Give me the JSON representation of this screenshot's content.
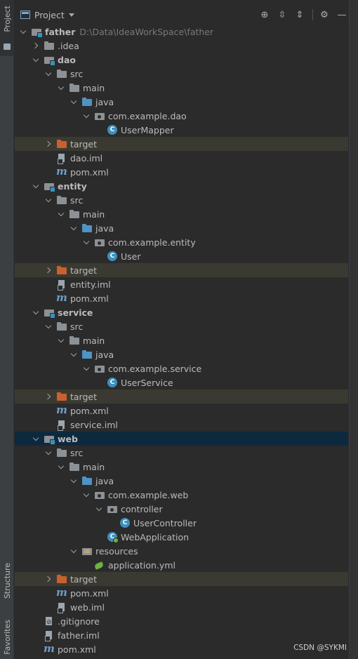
{
  "sidebar": {
    "project_label": "Project",
    "structure_label": "Structure",
    "favorites_label": "Favorites"
  },
  "header": {
    "title": "Project",
    "tools": [
      "locate-icon",
      "expand-all-icon",
      "collapse-all-icon",
      "gear-icon",
      "minimize-icon"
    ]
  },
  "tree": {
    "rows": [
      {
        "name": "father",
        "path": "D:\\Data\\IdeaWorkSpace\\father",
        "depth": 0,
        "arrow": "open",
        "icon": "module",
        "bold": true
      },
      {
        "name": ".idea",
        "depth": 1,
        "arrow": "closed",
        "icon": "folder-grey"
      },
      {
        "name": "dao",
        "depth": 1,
        "arrow": "open",
        "icon": "module",
        "bold": true
      },
      {
        "name": "src",
        "depth": 2,
        "arrow": "open",
        "icon": "folder-grey"
      },
      {
        "name": "main",
        "depth": 3,
        "arrow": "open",
        "icon": "folder-grey"
      },
      {
        "name": "java",
        "depth": 4,
        "arrow": "open",
        "icon": "folder-blue"
      },
      {
        "name": "com.example.dao",
        "depth": 5,
        "arrow": "open",
        "icon": "package"
      },
      {
        "name": "UserMapper",
        "depth": 6,
        "arrow": "none",
        "icon": "class"
      },
      {
        "name": "target",
        "depth": 2,
        "arrow": "closed",
        "icon": "folder-orange",
        "excluded": true
      },
      {
        "name": "dao.iml",
        "depth": 2,
        "arrow": "none",
        "icon": "iml"
      },
      {
        "name": "pom.xml",
        "depth": 2,
        "arrow": "none",
        "icon": "pom"
      },
      {
        "name": "entity",
        "depth": 1,
        "arrow": "open",
        "icon": "module",
        "bold": true
      },
      {
        "name": "src",
        "depth": 2,
        "arrow": "open",
        "icon": "folder-grey"
      },
      {
        "name": "main",
        "depth": 3,
        "arrow": "open",
        "icon": "folder-grey"
      },
      {
        "name": "java",
        "depth": 4,
        "arrow": "open",
        "icon": "folder-blue"
      },
      {
        "name": "com.example.entity",
        "depth": 5,
        "arrow": "open",
        "icon": "package"
      },
      {
        "name": "User",
        "depth": 6,
        "arrow": "none",
        "icon": "class"
      },
      {
        "name": "target",
        "depth": 2,
        "arrow": "closed",
        "icon": "folder-orange",
        "excluded": true
      },
      {
        "name": "entity.iml",
        "depth": 2,
        "arrow": "none",
        "icon": "iml"
      },
      {
        "name": "pom.xml",
        "depth": 2,
        "arrow": "none",
        "icon": "pom"
      },
      {
        "name": "service",
        "depth": 1,
        "arrow": "open",
        "icon": "module",
        "bold": true
      },
      {
        "name": "src",
        "depth": 2,
        "arrow": "open",
        "icon": "folder-grey"
      },
      {
        "name": "main",
        "depth": 3,
        "arrow": "open",
        "icon": "folder-grey"
      },
      {
        "name": "java",
        "depth": 4,
        "arrow": "open",
        "icon": "folder-blue"
      },
      {
        "name": "com.example.service",
        "depth": 5,
        "arrow": "open",
        "icon": "package"
      },
      {
        "name": "UserService",
        "depth": 6,
        "arrow": "none",
        "icon": "class"
      },
      {
        "name": "target",
        "depth": 2,
        "arrow": "closed",
        "icon": "folder-orange",
        "excluded": true
      },
      {
        "name": "pom.xml",
        "depth": 2,
        "arrow": "none",
        "icon": "pom"
      },
      {
        "name": "service.iml",
        "depth": 2,
        "arrow": "none",
        "icon": "iml"
      },
      {
        "name": "web",
        "depth": 1,
        "arrow": "open",
        "icon": "module",
        "bold": true,
        "selected": true
      },
      {
        "name": "src",
        "depth": 2,
        "arrow": "open",
        "icon": "folder-grey"
      },
      {
        "name": "main",
        "depth": 3,
        "arrow": "open",
        "icon": "folder-grey"
      },
      {
        "name": "java",
        "depth": 4,
        "arrow": "open",
        "icon": "folder-blue"
      },
      {
        "name": "com.example.web",
        "depth": 5,
        "arrow": "open",
        "icon": "package"
      },
      {
        "name": "controller",
        "depth": 6,
        "arrow": "open",
        "icon": "package"
      },
      {
        "name": "UserController",
        "depth": 7,
        "arrow": "none",
        "icon": "class"
      },
      {
        "name": "WebApplication",
        "depth": 6,
        "arrow": "none",
        "icon": "boot-class"
      },
      {
        "name": "resources",
        "depth": 4,
        "arrow": "open",
        "icon": "resources"
      },
      {
        "name": "application.yml",
        "depth": 5,
        "arrow": "none",
        "icon": "yml"
      },
      {
        "name": "target",
        "depth": 2,
        "arrow": "closed",
        "icon": "folder-orange",
        "excluded": true
      },
      {
        "name": "pom.xml",
        "depth": 2,
        "arrow": "none",
        "icon": "pom"
      },
      {
        "name": "web.iml",
        "depth": 2,
        "arrow": "none",
        "icon": "iml"
      },
      {
        "name": ".gitignore",
        "depth": 1,
        "arrow": "none",
        "icon": "gitignore"
      },
      {
        "name": "father.iml",
        "depth": 1,
        "arrow": "none",
        "icon": "iml"
      },
      {
        "name": "pom.xml",
        "depth": 1,
        "arrow": "none",
        "icon": "pom"
      }
    ]
  },
  "watermark": "CSDN @SYKMI",
  "colors": {
    "background": "#2b2b2b",
    "excluded_row": "#3b3a32",
    "selected_row": "#0d293e",
    "target_folder": "#c7612e",
    "source_folder": "#4f93c4"
  }
}
